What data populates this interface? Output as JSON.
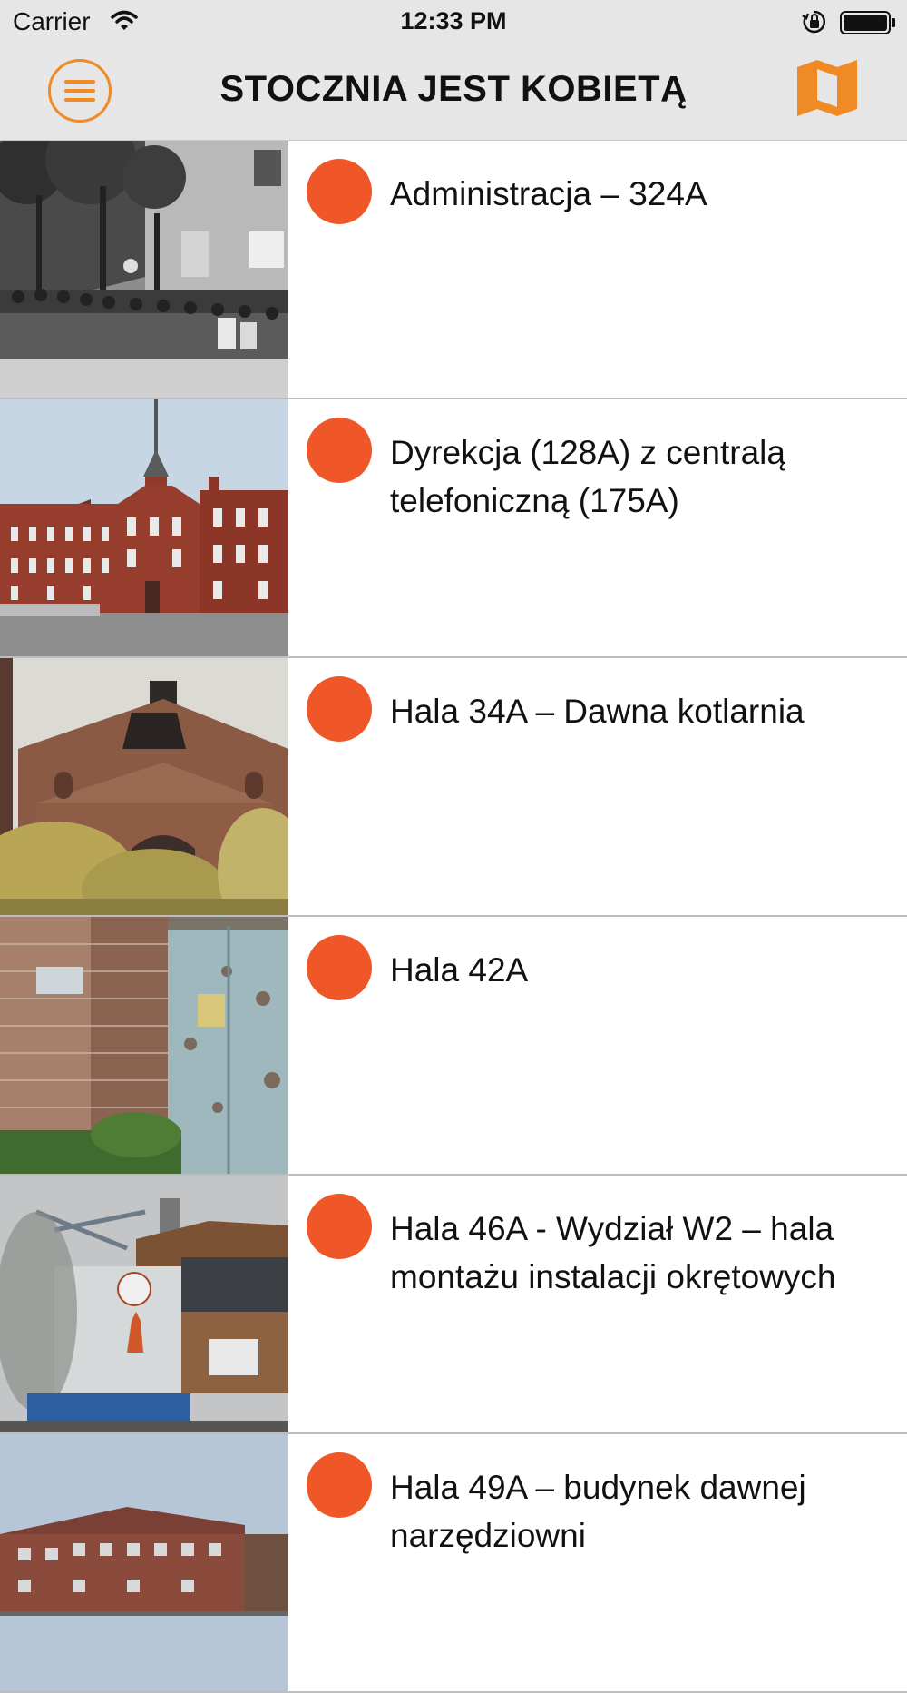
{
  "status_bar": {
    "carrier": "Carrier",
    "time": "12:33 PM"
  },
  "nav": {
    "title": "STOCZNIA JEST KOBIETĄ",
    "accent_color": "#f08a24",
    "menu_icon": "hamburger-menu-icon",
    "map_icon": "map-icon"
  },
  "marker_color": "#ef5628",
  "items": [
    {
      "title": "Administracja – 324A"
    },
    {
      "title": "Dyrekcja (128A) z centralą telefoniczną (175A)"
    },
    {
      "title": "Hala 34A – Dawna kotlarnia"
    },
    {
      "title": "Hala 42A"
    },
    {
      "title": "Hala 46A - Wydział W2 – hala montażu instalacji okrętowych"
    },
    {
      "title": "Hala 49A – budynek dawnej narzędziowni"
    }
  ]
}
